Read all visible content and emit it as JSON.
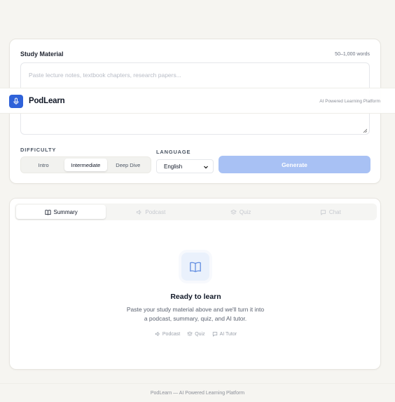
{
  "input": {
    "title": "Study Material",
    "word_limit": "50–1,000 words",
    "placeholder": "Paste lecture notes, textbook chapters, research papers..."
  },
  "header": {
    "brand": "PodLearn",
    "tagline": "AI Powered Learning Platform",
    "logo_icon": "microphone-icon",
    "accent": "#2f62d9"
  },
  "difficulty": {
    "label": "DIFFICULTY",
    "options": [
      "Intro",
      "Intermediate",
      "Deep Dive"
    ],
    "selected": "Intermediate"
  },
  "language": {
    "label": "LANGUAGE",
    "selected": "English"
  },
  "generate": {
    "label": "Generate",
    "color": "#a8c1f4"
  },
  "tabs": [
    {
      "label": "Summary",
      "icon": "book-icon",
      "active": true
    },
    {
      "label": "Podcast",
      "icon": "speaker-icon",
      "active": false
    },
    {
      "label": "Quiz",
      "icon": "layers-icon",
      "active": false
    },
    {
      "label": "Chat",
      "icon": "chat-icon",
      "active": false
    }
  ],
  "empty_state": {
    "icon": "book-icon",
    "title": "Ready to learn",
    "description": "Paste your study material above and we'll turn it into a podcast, summary, quiz, and AI tutor.",
    "features": [
      "Podcast",
      "Quiz",
      "AI Tutor"
    ]
  },
  "footer": {
    "text": "PodLearn — AI Powered Learning Platform"
  }
}
